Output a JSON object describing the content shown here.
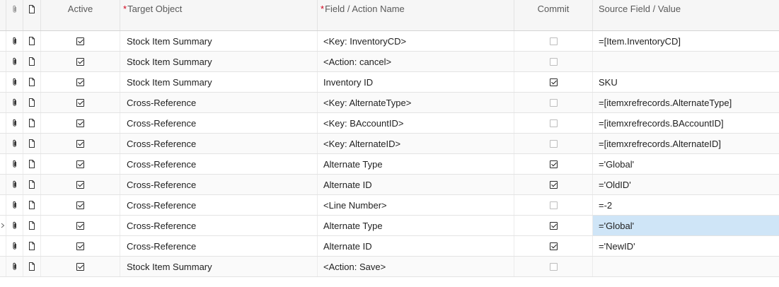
{
  "header": {
    "active": "Active",
    "target_object": "Target Object",
    "field_action": "Field / Action Name",
    "commit": "Commit",
    "source_value": "Source Field / Value",
    "required_mark": "*"
  },
  "selected_row_index": 9,
  "colors": {
    "selection": "#cfe5f7",
    "required": "#d0021b"
  },
  "rows": [
    {
      "active": true,
      "target_object": "Stock Item Summary",
      "field_action": "<Key: InventoryCD>",
      "commit": false,
      "source_value": "=[Item.InventoryCD]"
    },
    {
      "active": true,
      "target_object": "Stock Item Summary",
      "field_action": "<Action: cancel>",
      "commit": false,
      "source_value": ""
    },
    {
      "active": true,
      "target_object": "Stock Item Summary",
      "field_action": "Inventory ID",
      "commit": true,
      "source_value": "SKU"
    },
    {
      "active": true,
      "target_object": "Cross-Reference",
      "field_action": "<Key: AlternateType>",
      "commit": false,
      "source_value": "=[itemxrefrecords.AlternateType]"
    },
    {
      "active": true,
      "target_object": "Cross-Reference",
      "field_action": "<Key: BAccountID>",
      "commit": false,
      "source_value": "=[itemxrefrecords.BAccountID]"
    },
    {
      "active": true,
      "target_object": "Cross-Reference",
      "field_action": "<Key: AlternateID>",
      "commit": false,
      "source_value": "=[itemxrefrecords.AlternateID]"
    },
    {
      "active": true,
      "target_object": "Cross-Reference",
      "field_action": "Alternate Type",
      "commit": true,
      "source_value": "='Global'"
    },
    {
      "active": true,
      "target_object": "Cross-Reference",
      "field_action": "Alternate ID",
      "commit": true,
      "source_value": "='OldID'"
    },
    {
      "active": true,
      "target_object": "Cross-Reference",
      "field_action": "<Line Number>",
      "commit": false,
      "source_value": "=-2"
    },
    {
      "active": true,
      "target_object": "Cross-Reference",
      "field_action": "Alternate Type",
      "commit": true,
      "source_value": "='Global'"
    },
    {
      "active": true,
      "target_object": "Cross-Reference",
      "field_action": "Alternate ID",
      "commit": true,
      "source_value": "='NewID'"
    },
    {
      "active": true,
      "target_object": "Stock Item Summary",
      "field_action": "<Action: Save>",
      "commit": false,
      "source_value": ""
    }
  ]
}
